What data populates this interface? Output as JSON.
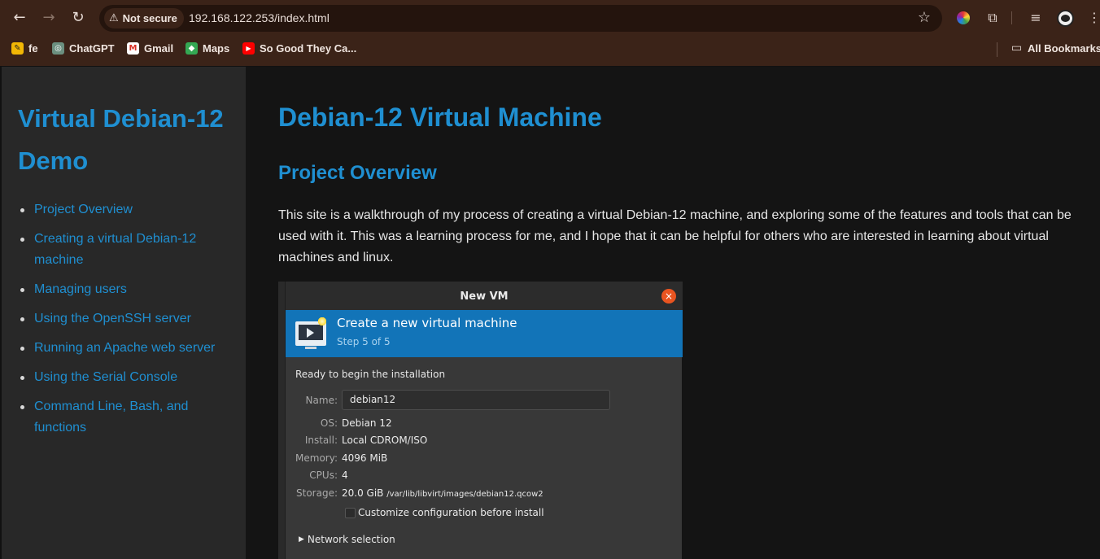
{
  "browser": {
    "nav": {
      "back_icon": "←",
      "forward_icon": "→",
      "reload_icon": "↻"
    },
    "security_chip": {
      "icon": "⚠",
      "label": "Not secure"
    },
    "url": "192.168.122.253/index.html",
    "star_icon": "☆",
    "toolbar_icons": {
      "extensions": "⧉",
      "media": "≡",
      "menu": "⋮"
    },
    "bookmarks": [
      {
        "label": "fe",
        "icon": "✎",
        "color": "#f2b705"
      },
      {
        "label": "ChatGPT",
        "icon": "◎",
        "color": "#6b8f7f"
      },
      {
        "label": "Gmail",
        "icon": "M",
        "color": "#d93025"
      },
      {
        "label": "Maps",
        "icon": "◆",
        "color": "#34a853"
      },
      {
        "label": "So Good They Ca...",
        "icon": "▶",
        "color": "#ff0000"
      }
    ],
    "all_bookmarks": {
      "icon": "▭",
      "label": "All Bookmarks"
    }
  },
  "sidebar": {
    "title": "Virtual Debian-12 Demo",
    "items": [
      "Project Overview",
      "Creating a virtual Debian-12 machine",
      "Managing users",
      "Using the OpenSSH server",
      "Running an Apache web server",
      "Using the Serial Console",
      "Command Line, Bash, and functions"
    ]
  },
  "main": {
    "heading": "Debian-12 Virtual Machine",
    "subheading": "Project Overview",
    "paragraph": "This site is a walkthrough of my process of creating a virtual Debian-12 machine, and exploring some of the features and tools that can be used with it. This was a learning process for me, and I hope that it can be helpful for others who are interested in learning about virtual machines and linux."
  },
  "vm_dialog": {
    "window_title": "New VM",
    "close_icon": "×",
    "banner_title": "Create a new virtual machine",
    "banner_step": "Step 5 of 5",
    "ready_text": "Ready to begin the installation",
    "name_label": "Name:",
    "name_value": "debian12",
    "os_label": "OS:",
    "os_value": "Debian 12",
    "install_label": "Install:",
    "install_value": "Local CDROM/ISO",
    "memory_label": "Memory:",
    "memory_value": "4096 MiB",
    "cpus_label": "CPUs:",
    "cpus_value": "4",
    "storage_label": "Storage:",
    "storage_size": "20.0 GiB",
    "storage_path": "/var/lib/libvirt/images/debian12.qcow2",
    "customize_label": "Customize configuration before install",
    "network_label": "Network selection",
    "network_icon": "▶"
  },
  "colors": {
    "accent_link": "#1f8fd1",
    "chrome_bg": "#3b2318",
    "banner_blue": "#1274b8",
    "close_orange": "#e95420"
  }
}
